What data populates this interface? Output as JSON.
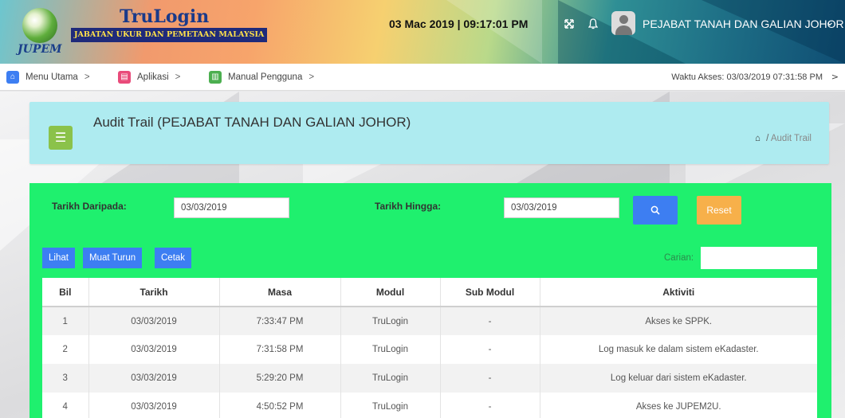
{
  "header": {
    "logo_text": "JUPEM",
    "app_title": "TruLogin",
    "app_subtitle": "JABATAN UKUR DAN PEMETAAN MALAYSIA",
    "datetime": "03 Mac 2019 | 09:17:01 PM",
    "user_name": "PEJABAT TANAH DAN GALIAN JOHOR",
    "icons": [
      "fullscreen-icon",
      "bell-icon",
      "avatar",
      "chevron-down-icon"
    ]
  },
  "nav": {
    "items": [
      {
        "label": "Menu Utama",
        "icon": "home-icon",
        "color": "#3d7ef2"
      },
      {
        "label": "Aplikasi",
        "icon": "app-icon",
        "color": "#e94b7a"
      },
      {
        "label": "Manual Pengguna",
        "icon": "book-icon",
        "color": "#4caf50"
      }
    ],
    "access_time": "Waktu Akses: 03/03/2019 07:31:58 PM"
  },
  "page": {
    "title": "Audit Trail (PEJABAT TANAH DAN GALIAN JOHOR)",
    "breadcrumb_current": "Audit Trail",
    "breadcrumb_sep": "/"
  },
  "filters": {
    "from_label": "Tarikh Daripada:",
    "from_value": "03/03/2019",
    "to_label": "Tarikh Hingga:",
    "to_value": "03/03/2019",
    "search_icon": "search-icon",
    "reset_label": "Reset"
  },
  "toolbar": {
    "view_label": "Lihat",
    "download_label": "Muat Turun",
    "print_label": "Cetak",
    "search_label": "Carian:",
    "search_value": ""
  },
  "table": {
    "headers": [
      "Bil",
      "Tarikh",
      "Masa",
      "Modul",
      "Sub Modul",
      "Aktiviti"
    ],
    "rows": [
      [
        "1",
        "03/03/2019",
        "7:33:47 PM",
        "TruLogin",
        "-",
        "Akses ke SPPK."
      ],
      [
        "2",
        "03/03/2019",
        "7:31:58 PM",
        "TruLogin",
        "-",
        "Log masuk ke dalam sistem eKadaster."
      ],
      [
        "3",
        "03/03/2019",
        "5:29:20 PM",
        "TruLogin",
        "-",
        "Log keluar dari sistem eKadaster."
      ],
      [
        "4",
        "03/03/2019",
        "4:50:52 PM",
        "TruLogin",
        "-",
        "Akses ke JUPEM2U."
      ]
    ]
  },
  "colors": {
    "panel_green": "#1ff06e",
    "title_panel": "#aeebf0",
    "primary_button": "#3d7ef2",
    "reset_button": "#f7b04a",
    "title_icon": "#8bc24a"
  }
}
